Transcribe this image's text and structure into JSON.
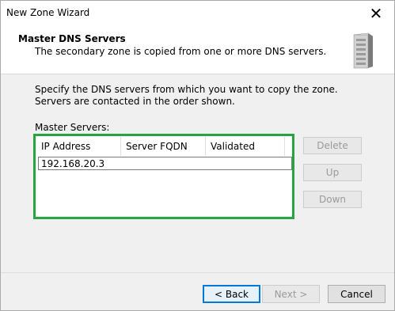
{
  "window": {
    "title": "New Zone Wizard"
  },
  "header": {
    "title": "Master DNS Servers",
    "subtitle": "The secondary zone is copied from one or more DNS servers."
  },
  "body": {
    "instructions": "Specify the DNS servers from which you want to copy the zone.  Servers are contacted in the order shown.",
    "master_label": "Master Servers:"
  },
  "table": {
    "columns": [
      "IP Address",
      "Server FQDN",
      "Validated"
    ],
    "rows": [
      {
        "ip": "192.168.20.3",
        "fqdn": "",
        "validated": ""
      }
    ]
  },
  "side_buttons": {
    "delete": "Delete",
    "up": "Up",
    "down": "Down"
  },
  "footer_buttons": {
    "back": "< Back",
    "next": "Next >",
    "cancel": "Cancel"
  },
  "colors": {
    "highlight": "#2aa343",
    "focus": "#0078d7"
  },
  "icons": {
    "close": "close-icon",
    "server": "server-icon"
  }
}
